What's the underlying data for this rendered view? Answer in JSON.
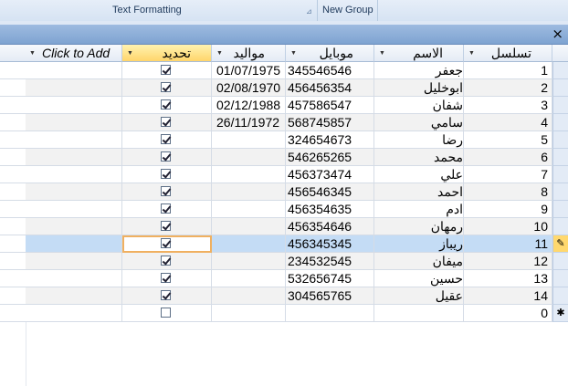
{
  "ribbon": {
    "group1_label": "Text Formatting",
    "group2_label": "New Group"
  },
  "window": {
    "close_glyph": "×"
  },
  "table": {
    "headers": {
      "seq": "تسلسل",
      "name": "الاسم",
      "mobile": "موبايل",
      "birth": "مواليد",
      "select": "تحديد",
      "add": "Click to Add"
    },
    "rows": [
      {
        "seq": "1",
        "name": "جعفر",
        "mobile": "345546546",
        "birth": "01/07/1975",
        "checked": true
      },
      {
        "seq": "2",
        "name": "ابوخليل",
        "mobile": "456456354",
        "birth": "02/08/1970",
        "checked": true
      },
      {
        "seq": "3",
        "name": "شفان",
        "mobile": "457586547",
        "birth": "02/12/1988",
        "checked": true
      },
      {
        "seq": "4",
        "name": "سامي",
        "mobile": "568745857",
        "birth": "26/11/1972",
        "checked": true
      },
      {
        "seq": "5",
        "name": "رضا",
        "mobile": "324654673",
        "birth": "",
        "checked": true
      },
      {
        "seq": "6",
        "name": "محمد",
        "mobile": "546265265",
        "birth": "",
        "checked": true
      },
      {
        "seq": "7",
        "name": "علي",
        "mobile": "456373474",
        "birth": "",
        "checked": true
      },
      {
        "seq": "8",
        "name": "احمد",
        "mobile": "456546345",
        "birth": "",
        "checked": true
      },
      {
        "seq": "9",
        "name": "ادم",
        "mobile": "456354635",
        "birth": "",
        "checked": true
      },
      {
        "seq": "10",
        "name": "رمهان",
        "mobile": "456354646",
        "birth": "",
        "checked": true
      },
      {
        "seq": "11",
        "name": "ريباز",
        "mobile": "456345345",
        "birth": "",
        "checked": true,
        "current": true
      },
      {
        "seq": "12",
        "name": "ميفان",
        "mobile": "234532545",
        "birth": "",
        "checked": true
      },
      {
        "seq": "13",
        "name": "حسين",
        "mobile": "532656745",
        "birth": "",
        "checked": true
      },
      {
        "seq": "14",
        "name": "عقيل",
        "mobile": "304565765",
        "birth": "",
        "checked": true
      }
    ],
    "new_row": {
      "seq": "0",
      "checked": false
    },
    "new_row_marker": "✱",
    "edit_marker": "✎"
  },
  "colors": {
    "current_row": "#c4dcf5",
    "active_header": "#ffd56b",
    "alt_row": "#f2f2f2",
    "focus_border": "#f0b060"
  }
}
